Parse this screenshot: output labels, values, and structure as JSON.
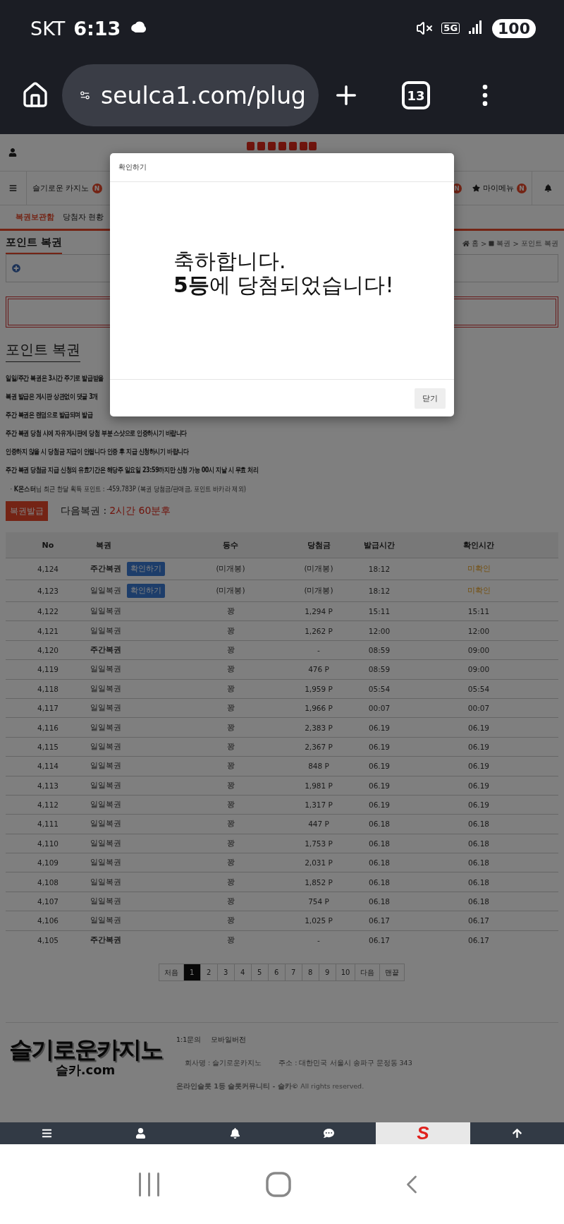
{
  "status_bar": {
    "carrier": "SKT",
    "time": "6:13",
    "network": "5G",
    "battery": "100"
  },
  "browser": {
    "url": "seulca1.com/plug",
    "tab_count": "13"
  },
  "nav": {
    "left": [
      {
        "label": "슬기로운 카지노",
        "badge": "N"
      }
    ],
    "right": [
      {
        "badge": "N",
        "starred": false
      },
      {
        "label": "마이메뉴",
        "badge": "N",
        "starred": true
      }
    ]
  },
  "sub_tabs": [
    {
      "label": "복권보관함",
      "selected": true
    },
    {
      "label": "당첨자 현황",
      "selected": false
    }
  ],
  "page_title": "포인트 복권",
  "breadcrumb": {
    "items": [
      "홈",
      "복권",
      "포인트 복권"
    ],
    "separator": ">"
  },
  "section_title": "포인트 복권",
  "notices": [
    "일일/주간 복권은 3시간 주기로 발급받을",
    "복권 발급은 게시판 상관없이 댓글 3개",
    "주간 복권은 랜덤으로 발급되며 발급",
    "주간 복권 당첨 시에 자유게시판에 당첨 부분 스샷으로 인증하시기 바랍니다",
    "인증하지 않을 시 당첨금 지급이 안됩니다 인증 후 지급 신청하시기 바랍니다",
    "주간 복권 당첨금 지급 신청의 유효기간은 해당주 일요일 23:59까지만 신청 가능 00시 지날 시 무효 처리"
  ],
  "points_note": "· **K몬스터**님 최근 한달 획득 포인트 : -459,783P (복권 당첨금/판매금, 포인트 바카라 제외)",
  "issue_button": "복권발급",
  "next_label": "다음복권 :",
  "next_value": "2시간 60분후",
  "table": {
    "columns": [
      "No",
      "복권",
      "등수",
      "당첨금",
      "발급시간",
      "확인시간"
    ],
    "rows": [
      {
        "no": "4,124",
        "ticket": "주간복권",
        "weekly": true,
        "action": "확인하기",
        "rank": "(미개봉)",
        "prize": "(미개봉)",
        "issued": "18:12",
        "checked": "미확인",
        "confirmed": false
      },
      {
        "no": "4,123",
        "ticket": "일일복권",
        "weekly": false,
        "action": "확인하기",
        "rank": "(미개봉)",
        "prize": "(미개봉)",
        "issued": "18:12",
        "checked": "미확인",
        "confirmed": false
      },
      {
        "no": "4,122",
        "ticket": "일일복권",
        "weekly": false,
        "rank": "꽝",
        "prize": "1,294 P",
        "issued": "15:11",
        "checked": "15:11",
        "confirmed": true
      },
      {
        "no": "4,121",
        "ticket": "일일복권",
        "weekly": false,
        "rank": "꽝",
        "prize": "1,262 P",
        "issued": "12:00",
        "checked": "12:00",
        "confirmed": true
      },
      {
        "no": "4,120",
        "ticket": "주간복권",
        "weekly": true,
        "rank": "꽝",
        "prize": "-",
        "issued": "08:59",
        "checked": "09:00",
        "confirmed": true
      },
      {
        "no": "4,119",
        "ticket": "일일복권",
        "weekly": false,
        "rank": "꽝",
        "prize": "476 P",
        "issued": "08:59",
        "checked": "09:00",
        "confirmed": true
      },
      {
        "no": "4,118",
        "ticket": "일일복권",
        "weekly": false,
        "rank": "꽝",
        "prize": "1,959 P",
        "issued": "05:54",
        "checked": "05:54",
        "confirmed": true
      },
      {
        "no": "4,117",
        "ticket": "일일복권",
        "weekly": false,
        "rank": "꽝",
        "prize": "1,966 P",
        "issued": "00:07",
        "checked": "00:07",
        "confirmed": true
      },
      {
        "no": "4,116",
        "ticket": "일일복권",
        "weekly": false,
        "rank": "꽝",
        "prize": "2,383 P",
        "issued": "06.19",
        "checked": "06.19",
        "confirmed": true
      },
      {
        "no": "4,115",
        "ticket": "일일복권",
        "weekly": false,
        "rank": "꽝",
        "prize": "2,367 P",
        "issued": "06.19",
        "checked": "06.19",
        "confirmed": true
      },
      {
        "no": "4,114",
        "ticket": "일일복권",
        "weekly": false,
        "rank": "꽝",
        "prize": "848 P",
        "issued": "06.19",
        "checked": "06.19",
        "confirmed": true
      },
      {
        "no": "4,113",
        "ticket": "일일복권",
        "weekly": false,
        "rank": "꽝",
        "prize": "1,981 P",
        "issued": "06.19",
        "checked": "06.19",
        "confirmed": true
      },
      {
        "no": "4,112",
        "ticket": "일일복권",
        "weekly": false,
        "rank": "꽝",
        "prize": "1,317 P",
        "issued": "06.19",
        "checked": "06.19",
        "confirmed": true
      },
      {
        "no": "4,111",
        "ticket": "일일복권",
        "weekly": false,
        "rank": "꽝",
        "prize": "447 P",
        "issued": "06.18",
        "checked": "06.18",
        "confirmed": true
      },
      {
        "no": "4,110",
        "ticket": "일일복권",
        "weekly": false,
        "rank": "꽝",
        "prize": "1,753 P",
        "issued": "06.18",
        "checked": "06.18",
        "confirmed": true
      },
      {
        "no": "4,109",
        "ticket": "일일복권",
        "weekly": false,
        "rank": "꽝",
        "prize": "2,031 P",
        "issued": "06.18",
        "checked": "06.18",
        "confirmed": true
      },
      {
        "no": "4,108",
        "ticket": "일일복권",
        "weekly": false,
        "rank": "꽝",
        "prize": "1,852 P",
        "issued": "06.18",
        "checked": "06.18",
        "confirmed": true
      },
      {
        "no": "4,107",
        "ticket": "일일복권",
        "weekly": false,
        "rank": "꽝",
        "prize": "754 P",
        "issued": "06.18",
        "checked": "06.18",
        "confirmed": true
      },
      {
        "no": "4,106",
        "ticket": "일일복권",
        "weekly": false,
        "rank": "꽝",
        "prize": "1,025 P",
        "issued": "06.17",
        "checked": "06.17",
        "confirmed": true
      },
      {
        "no": "4,105",
        "ticket": "주간복권",
        "weekly": true,
        "rank": "꽝",
        "prize": "-",
        "issued": "06.17",
        "checked": "06.17",
        "confirmed": true
      }
    ]
  },
  "pagination": [
    {
      "label": "처음",
      "selected": false
    },
    {
      "label": "1",
      "selected": true
    },
    {
      "label": "2",
      "selected": false
    },
    {
      "label": "3",
      "selected": false
    },
    {
      "label": "4",
      "selected": false
    },
    {
      "label": "5",
      "selected": false
    },
    {
      "label": "6",
      "selected": false
    },
    {
      "label": "7",
      "selected": false
    },
    {
      "label": "8",
      "selected": false
    },
    {
      "label": "9",
      "selected": false
    },
    {
      "label": "10",
      "selected": false
    },
    {
      "label": "다음",
      "selected": false
    },
    {
      "label": "맨끝",
      "selected": false
    }
  ],
  "footer": {
    "logo": "슬기로운카지노",
    "logo_domain": "슬카.com",
    "links": [
      "1:1문의",
      "모바일버전"
    ],
    "company": "회사명 : 슬기로운카지노",
    "address": "주소 : 대한민국 서울시 송파구 문정동 343",
    "copyright": "**온라인슬롯 1등 슬롯커뮤니티 - 슬카©** All rights reserved."
  },
  "bottom_nav": [
    {
      "kind": "menu",
      "selected": false
    },
    {
      "kind": "user",
      "selected": false
    },
    {
      "kind": "bell",
      "selected": false
    },
    {
      "kind": "chat",
      "selected": false
    },
    {
      "kind": "logo",
      "label": "S",
      "selected": true
    },
    {
      "kind": "top",
      "selected": false
    }
  ],
  "modal": {
    "title": "확인하기",
    "line1": "축하합니다.",
    "line2": "**5등**에 당첨되었습니다!",
    "close": "닫기"
  }
}
